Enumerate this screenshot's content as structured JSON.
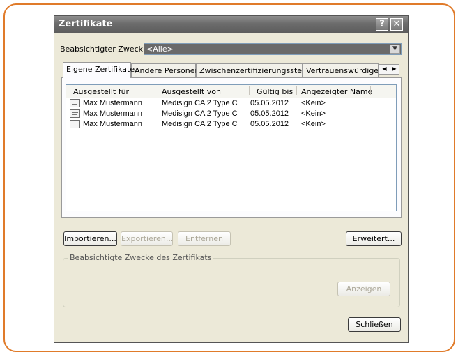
{
  "dialog": {
    "title": "Zertifikate",
    "help_glyph": "?",
    "close_glyph": "✕"
  },
  "purpose": {
    "label": "Beabsichtigter Zweck:",
    "value": "<Alle>"
  },
  "tabs": [
    {
      "label": "Eigene Zertifikate",
      "active": true
    },
    {
      "label": "Andere Personen",
      "active": false
    },
    {
      "label": "Zwischenzertifizierungsstellen",
      "active": false
    },
    {
      "label": "Vertrauenswürdige S",
      "active": false
    }
  ],
  "table": {
    "columns": [
      "Ausgestellt für",
      "Ausgestellt von",
      "Gültig bis",
      "Angezeigter Name"
    ],
    "rows": [
      [
        "Max Mustermann",
        "Medisign CA 2 Type C",
        "05.05.2012",
        "<Kein>"
      ],
      [
        "Max Mustermann",
        "Medisign CA 2 Type C",
        "05.05.2012",
        "<Kein>"
      ],
      [
        "Max Mustermann",
        "Medisign CA 2 Type C",
        "05.05.2012",
        "<Kein>"
      ]
    ]
  },
  "buttons": {
    "import": "Importieren...",
    "export": "Exportieren...",
    "remove": "Entfernen",
    "advanced": "Erweitert...",
    "view": "Anzeigen",
    "close": "Schließen"
  },
  "purposes_group": {
    "label": "Beabsichtigte Zwecke des Zertifikats"
  },
  "icons": {
    "certificate": "certificate-icon",
    "dropdown": "chevron-down-icon",
    "tab_left": "chevron-left-icon",
    "tab_right": "chevron-right-icon"
  },
  "colors": {
    "frame": "#e07b2a",
    "titlebar": "#6c6c6c",
    "dialog_bg": "#ece9d8"
  }
}
